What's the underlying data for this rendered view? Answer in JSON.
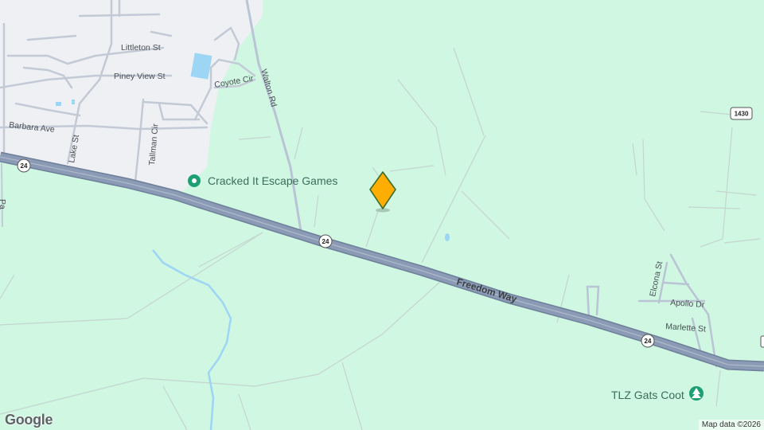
{
  "streets": {
    "littleton": "Littleton St",
    "piney_view": "Piney View St",
    "coyote": "Coyote Cir",
    "walton": "Walton Rd",
    "barbara": "Barbara Ave",
    "lake": "Lake St",
    "tallman": "Tallman Cir",
    "freedom_way": "Freedom Way",
    "elcona": "Elcona St",
    "apollo": "Apollo Dr",
    "marlette": "Marlette St"
  },
  "shields": {
    "r24_west": "24",
    "r24_mid": "24",
    "r24_east": "24",
    "r1430": "1430"
  },
  "pois": {
    "cracked_it": "Cracked It Escape Games",
    "tlz": "TLZ Gats Coot"
  },
  "footer": {
    "logo": "Google",
    "attribution": "Map data ©2026"
  },
  "colors": {
    "land": "#cff7e2",
    "urban": "#eef0f3",
    "highway": "#8797b0",
    "water": "#9dd5f5",
    "marker": "#ffad00",
    "poi_green": "#1e9f73"
  }
}
